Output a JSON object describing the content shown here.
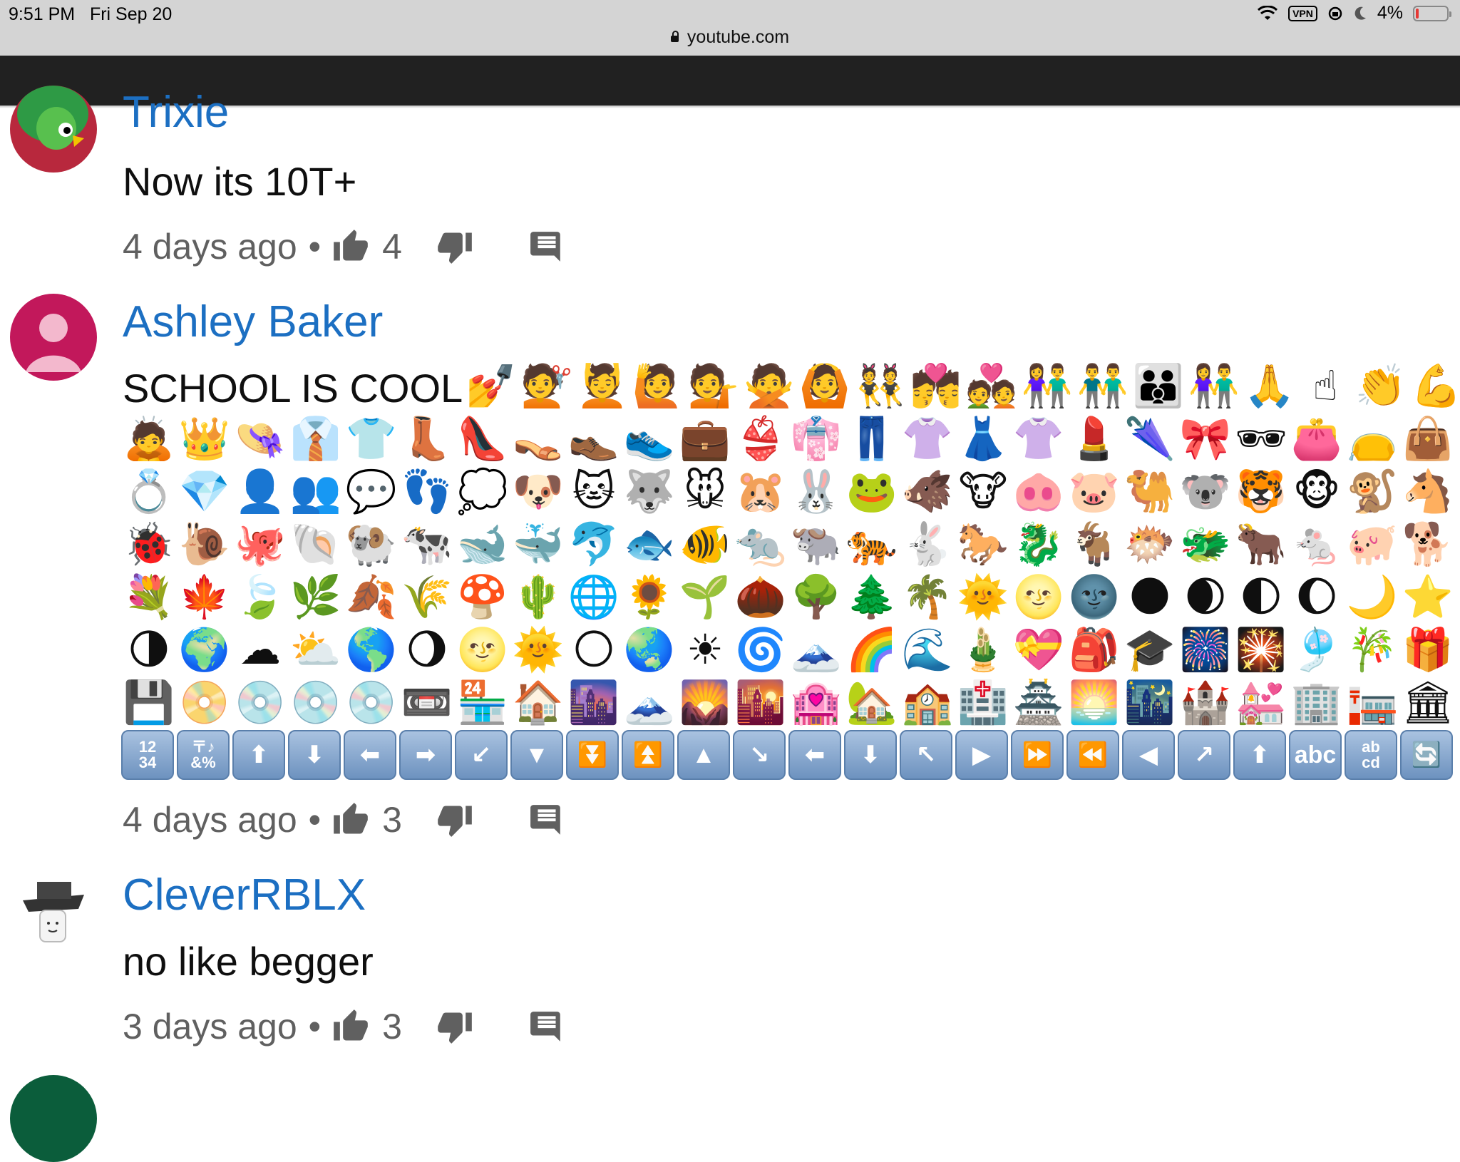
{
  "status_bar": {
    "time": "9:51 PM",
    "date": "Fri Sep 20",
    "vpn": "VPN",
    "battery": "4%"
  },
  "url_bar": {
    "url": "youtube.com"
  },
  "comments": [
    {
      "author": "Trixie",
      "text": "Now its 10T+",
      "time": "4 days ago",
      "separator": "•",
      "likes": "4",
      "avatar_color": "#b8283d"
    },
    {
      "author": "Ashley Baker",
      "text": "SCHOOL IS COOL",
      "time": "4 days ago",
      "separator": "•",
      "likes": "3",
      "avatar_color": "#c2185b"
    },
    {
      "author": "CleverRBLX",
      "text": "no like begger",
      "time": "3 days ago",
      "separator": "•",
      "likes": "3",
      "avatar_color": "#ffffff"
    }
  ],
  "emoji_row1": [
    "💅",
    "💇",
    "💆",
    "🙋",
    "💁",
    "🙅",
    "🙆",
    "👯",
    "💏",
    "💑",
    "👫",
    "👬",
    "👪",
    "👫",
    "🙏",
    "☝",
    "👏",
    "💪"
  ],
  "emoji_grid": [
    "🙇",
    "👑",
    "👒",
    "👔",
    "👕",
    "👢",
    "👠",
    "👡",
    "👞",
    "👟",
    "💼",
    "👙",
    "👘",
    "👖",
    "👚",
    "👗",
    "👚",
    "💄",
    "🌂",
    "🎀",
    "🕶",
    "👛",
    "👝",
    "👜",
    "💍",
    "💎",
    "👤",
    "👥",
    "💬",
    "👣",
    "💭",
    "🐶",
    "🐱",
    "🐺",
    "🐭",
    "🐹",
    "🐰",
    "🐸",
    "🐗",
    "🐮",
    "🐽",
    "🐷",
    "🐫",
    "🐨",
    "🐯",
    "🐵",
    "🐒",
    "🐴",
    "🐞",
    "🐌",
    "🐙",
    "🐚",
    "🐏",
    "🐄",
    "🐋",
    "🐳",
    "🐬",
    "🐟",
    "🐠",
    "🐀",
    "🐃",
    "🐅",
    "🐇",
    "🐎",
    "🐉",
    "🐐",
    "🐡",
    "🐲",
    "🐂",
    "🐁",
    "🐖",
    "🐕",
    "💐",
    "🍁",
    "🍃",
    "🌿",
    "🍂",
    "🌾",
    "🍄",
    "🌵",
    "🌐",
    "🌻",
    "🌱",
    "🌰",
    "🌳",
    "🌲",
    "🌴",
    "🌞",
    "🌝",
    "🌚",
    "🌑",
    "🌒",
    "🌓",
    "🌔",
    "🌙",
    "⭐",
    "🌗",
    "🌍",
    "☁",
    "⛅",
    "🌎",
    "🌖",
    "🌝",
    "🌞",
    "🌕",
    "🌏",
    "☀",
    "🌀",
    "🗻",
    "🌈",
    "🌊",
    "🎍",
    "💝",
    "🎒",
    "🎓",
    "🎆",
    "🎇",
    "🎐",
    "🎋",
    "🎁",
    "💾",
    "📀",
    "💿",
    "💿",
    "💿",
    "📼",
    "🏪",
    "🏠",
    "🌆",
    "🗻",
    "🌄",
    "🌇",
    "🏩",
    "🏡",
    "🏫",
    "🏥",
    "🏯",
    "🌅",
    "🌃",
    "🏰",
    "💒",
    "🏢",
    "🏣",
    "🏛"
  ],
  "keys": [
    "12\n34",
    "〒♪\n&%",
    "⬆",
    "⬇",
    "⬅",
    "➡",
    "↙",
    "▼",
    "⏬",
    "⏫",
    "▲",
    "↘",
    "⬅",
    "⬇",
    "↖",
    "▶",
    "⏩",
    "⏪",
    "◀",
    "↗",
    "⬆",
    "abc",
    "ab\ncd",
    "🔄"
  ],
  "colors": {
    "author_link": "#1c6fc2",
    "meta_text": "#606060",
    "navbar": "#212121"
  }
}
